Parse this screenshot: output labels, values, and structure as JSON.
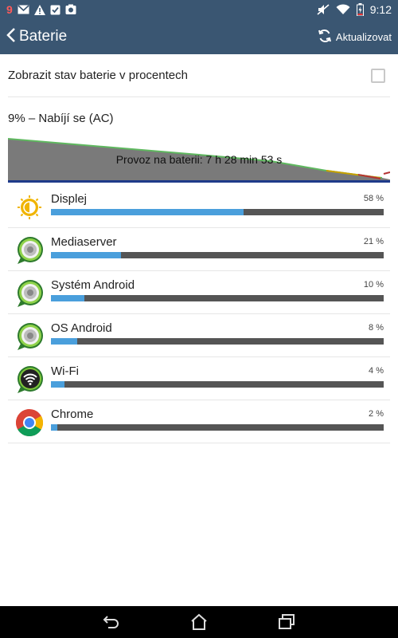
{
  "status_bar": {
    "notification_count": "9",
    "time": "9:12",
    "icons": [
      "gmail-icon",
      "warning-icon",
      "task-icon",
      "photo-icon",
      "mute-icon",
      "wifi-icon",
      "battery-charging-icon"
    ]
  },
  "header": {
    "title": "Baterie",
    "refresh_label": "Aktualizovat"
  },
  "preference": {
    "label": "Zobrazit stav baterie v procentech",
    "checked": false
  },
  "battery": {
    "status": "9% – Nabíjí se (AC)",
    "graph_label": "Provoz na baterii: 7 h 28 min 53 s"
  },
  "usage": [
    {
      "name": "Displej",
      "percent_text": "58 %",
      "percent": 58,
      "icon": "brightness-icon"
    },
    {
      "name": "Mediaserver",
      "percent_text": "21 %",
      "percent": 21,
      "icon": "android-system-icon"
    },
    {
      "name": "Systém Android",
      "percent_text": "10 %",
      "percent": 10,
      "icon": "android-system-icon"
    },
    {
      "name": "OS Android",
      "percent_text": "8 %",
      "percent": 8,
      "icon": "android-system-icon"
    },
    {
      "name": "Wi-Fi",
      "percent_text": "4 %",
      "percent": 4,
      "icon": "wifi-icon"
    },
    {
      "name": "Chrome",
      "percent_text": "2 %",
      "percent": 2,
      "icon": "chrome-icon"
    }
  ],
  "colors": {
    "header_bg": "#3a5672",
    "bar_fill": "#4a9fdc",
    "bar_track": "#555555",
    "graph_fill": "#7a7a7a",
    "graph_line": "#5fb85f"
  }
}
